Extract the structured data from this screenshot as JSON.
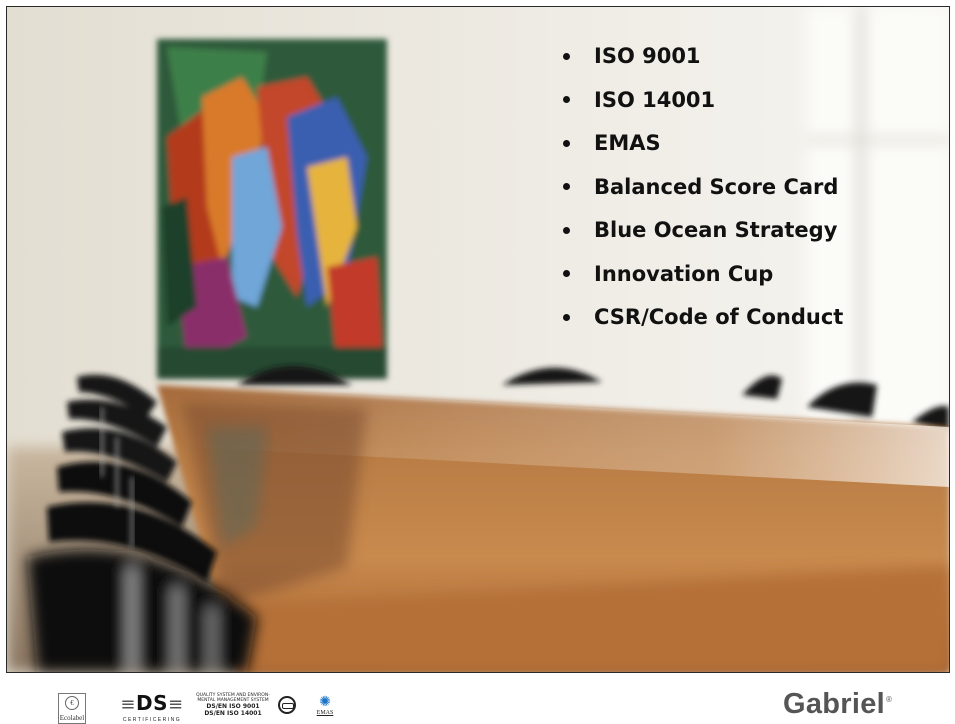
{
  "slide": {
    "bullets": [
      "ISO 9001",
      "ISO 14001",
      "EMAS",
      "Balanced Score Card",
      "Blue Ocean Strategy",
      "Innovation Cup",
      "CSR/Code of Conduct"
    ]
  },
  "footer": {
    "logos": {
      "ecolabel": "Ecolabel",
      "ds_main": "DS",
      "ds_sub": "CERTIFICERING",
      "iso_line1": "QUALITY SYSTEM AND ENVIRON-",
      "iso_line2": "MENTAL MANAGEMENT SYSTEM",
      "iso_line3": "DS/EN ISO 9001",
      "iso_line4": "DS/EN ISO 14001",
      "emas": "EMAS"
    },
    "brand": "Gabriel",
    "brand_mark": "®"
  },
  "colors": {
    "text": "#111111",
    "brand": "#555555",
    "emas_accent": "#1a73c9"
  }
}
